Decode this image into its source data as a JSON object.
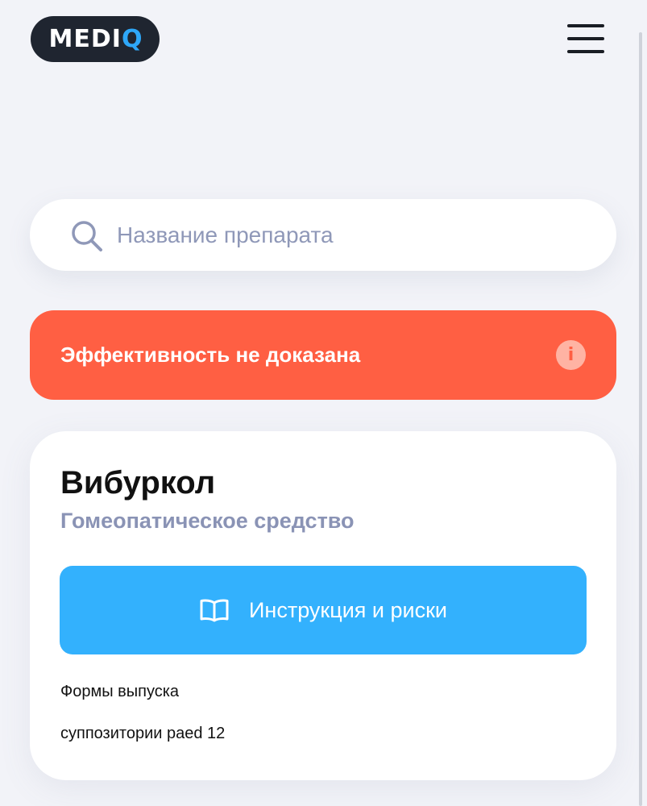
{
  "header": {
    "logo_main": "MEDI",
    "logo_accent": "Q"
  },
  "search": {
    "placeholder": "Название препарата",
    "value": ""
  },
  "alert": {
    "text": "Эффективность не доказана",
    "info_symbol": "i"
  },
  "drug": {
    "name": "Вибуркол",
    "category": "Гомеопатическое средство",
    "instructions_label": "Инструкция и риски",
    "forms_title": "Формы выпуска",
    "forms": [
      "суппозитории paed 12"
    ]
  },
  "colors": {
    "background": "#f2f3f8",
    "logo_bg": "#1f2530",
    "logo_accent": "#2ea7f8",
    "alert_bg": "#ff5f43",
    "button_bg": "#33b1fd",
    "muted_text": "#8a93b5"
  },
  "icons": {
    "menu": "hamburger-icon",
    "search": "search-icon",
    "info": "info-icon",
    "instructions": "book-icon"
  }
}
